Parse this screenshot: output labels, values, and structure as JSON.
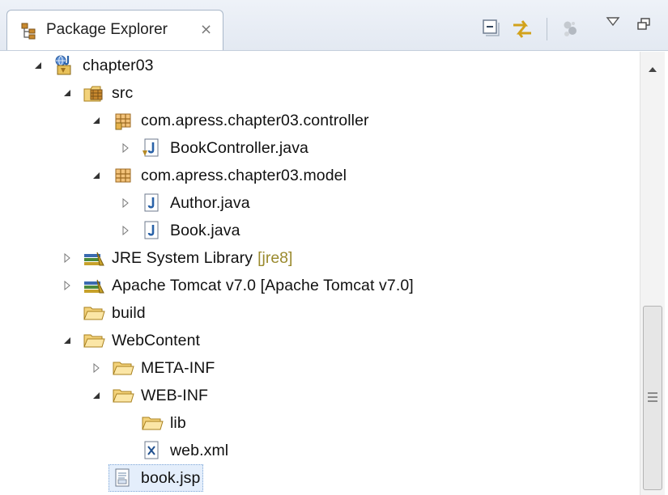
{
  "view": {
    "title": "Package Explorer",
    "close_glyph": "⨯",
    "toolbar": {
      "collapse_all_icon": "collapse-all-icon",
      "link_with_editor_icon": "link-with-editor-icon",
      "filter_icon": "filter-icon",
      "view_menu_icon": "view-menu-icon",
      "minimize_icon": "minimize-icon"
    }
  },
  "tree": [
    {
      "label": "chapter03",
      "expanded": true,
      "icon": "web-project-icon"
    },
    {
      "label": "src",
      "expanded": true,
      "icon": "source-folder-icon"
    },
    {
      "label": "com.apress.chapter03.controller",
      "expanded": true,
      "icon": "package-icon"
    },
    {
      "label": "BookController.java",
      "expanded": false,
      "icon": "java-file-icon"
    },
    {
      "label": "com.apress.chapter03.model",
      "expanded": true,
      "icon": "package-icon"
    },
    {
      "label": "Author.java",
      "expanded": false,
      "icon": "java-file-icon"
    },
    {
      "label": "Book.java",
      "expanded": false,
      "icon": "java-file-icon"
    },
    {
      "label": "JRE System Library",
      "decoration": "[jre8]",
      "expanded": false,
      "icon": "library-icon"
    },
    {
      "label": "Apache Tomcat v7.0 [Apache Tomcat v7.0]",
      "expanded": false,
      "icon": "library-icon"
    },
    {
      "label": "build",
      "icon": "folder-icon"
    },
    {
      "label": "WebContent",
      "expanded": true,
      "icon": "folder-open-icon"
    },
    {
      "label": "META-INF",
      "expanded": false,
      "icon": "folder-icon"
    },
    {
      "label": "WEB-INF",
      "expanded": true,
      "icon": "folder-open-icon"
    },
    {
      "label": "lib",
      "icon": "folder-icon"
    },
    {
      "label": "web.xml",
      "icon": "xml-file-icon"
    },
    {
      "label": "book.jsp",
      "icon": "jsp-file-icon",
      "selected": true
    }
  ],
  "colors": {
    "folder": "#f3d27a",
    "java_j": "#2a62a8",
    "package": "#c9892e",
    "library_books": "#3a6ab0",
    "selection": "#e4eefb",
    "jre_decoration": "#9a8a2e"
  }
}
